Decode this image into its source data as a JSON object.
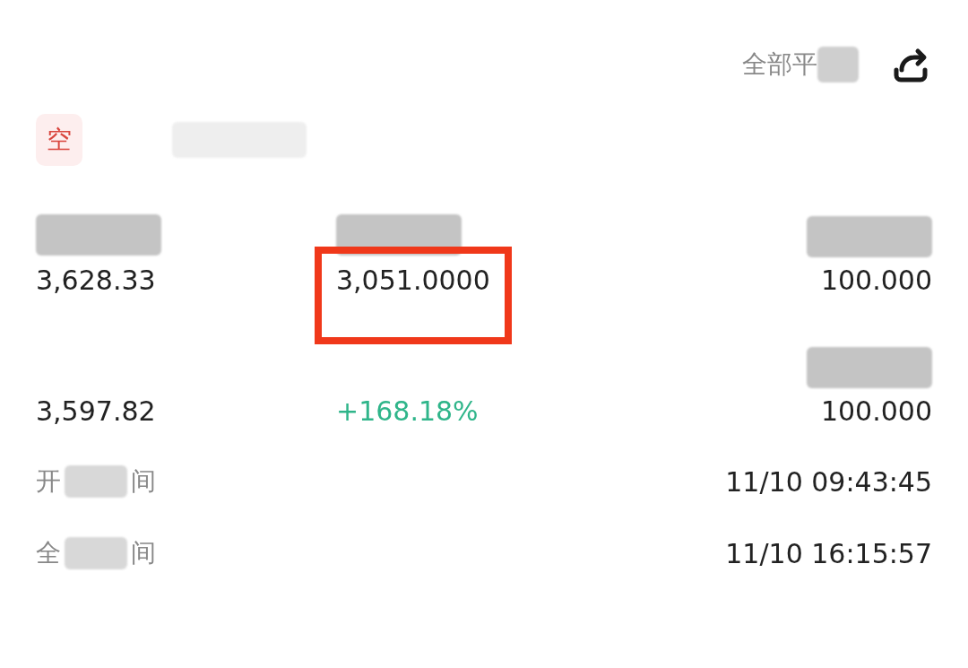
{
  "header": {
    "close_all_label": "全部平"
  },
  "position": {
    "side": "空"
  },
  "stat_rows": [
    {
      "cells": [
        {
          "value": "3,628.33",
          "kind": "plain",
          "highlighted": false
        },
        {
          "value": "3,051.0000",
          "kind": "plain",
          "highlighted": true
        },
        {
          "value": "100.000",
          "kind": "plain",
          "highlighted": false
        }
      ]
    },
    {
      "cells": [
        {
          "value": "3,597.82",
          "kind": "plain",
          "highlighted": false
        },
        {
          "value": "+168.18%",
          "kind": "gain",
          "highlighted": false
        },
        {
          "value": "100.000",
          "kind": "plain",
          "highlighted": false
        }
      ]
    }
  ],
  "time_rows": [
    {
      "label_start": "开",
      "label_end": "间",
      "value": "11/10 09:43:45"
    },
    {
      "label_start": "全",
      "label_end": "间",
      "value": "11/10 16:15:57"
    }
  ]
}
